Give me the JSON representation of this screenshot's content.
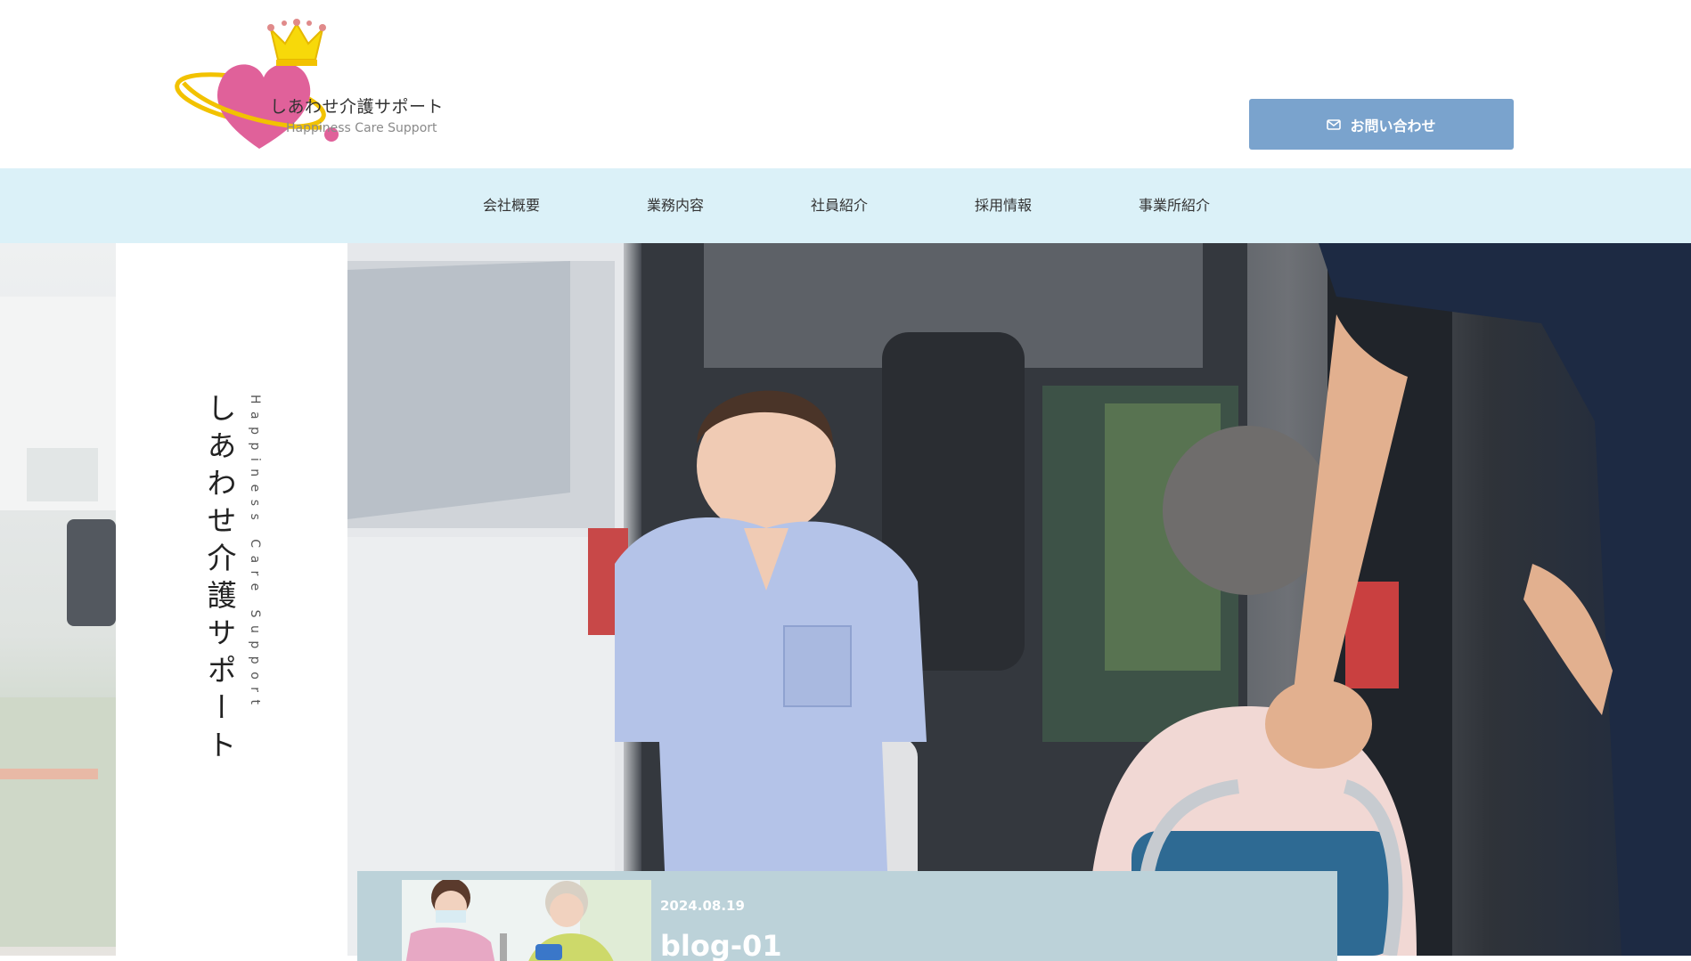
{
  "header": {
    "logo": {
      "title": "しあわせ介護サポート",
      "subtitle": "Happiness Care Support"
    },
    "contact_button": {
      "label": "お問い合わせ",
      "icon": "mail-icon"
    }
  },
  "nav": {
    "items": [
      {
        "label": "会社概要"
      },
      {
        "label": "業務内容"
      },
      {
        "label": "社員紹介"
      },
      {
        "label": "採用情報"
      },
      {
        "label": "事業所紹介"
      }
    ]
  },
  "hero": {
    "title_jp": "しあわせ介護サポート",
    "title_en": "Happiness Care Support"
  },
  "blog": {
    "date": "2024.08.19",
    "title": "blog-01"
  },
  "colors": {
    "nav_bg": "#dbf1f8",
    "button_bg": "#7aa3cd",
    "blog_card_bg": "#bcd2d9"
  }
}
